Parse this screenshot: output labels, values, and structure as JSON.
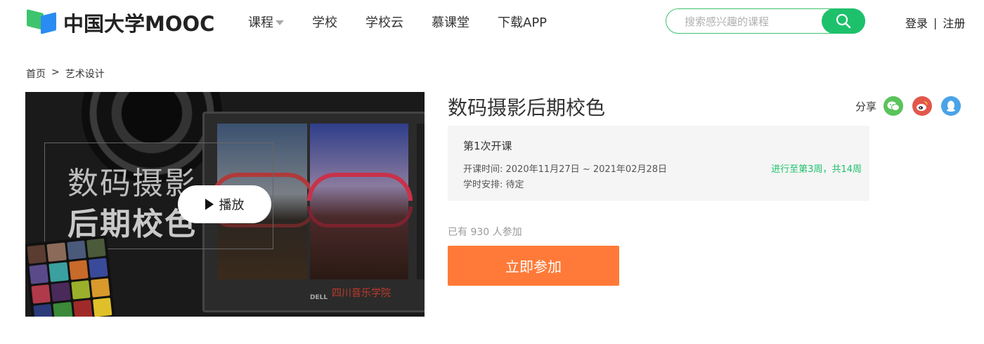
{
  "header": {
    "logo_text": "中国大学MOOC",
    "nav": [
      {
        "label": "课程",
        "has_dropdown": true
      },
      {
        "label": "学校"
      },
      {
        "label": "学校云"
      },
      {
        "label": "慕课堂"
      },
      {
        "label": "下载APP"
      }
    ],
    "search": {
      "placeholder": "搜索感兴趣的课程",
      "icon": "search-icon"
    },
    "auth": {
      "login": "登录",
      "separator": "|",
      "register": "注册"
    }
  },
  "breadcrumb": {
    "home": "首页",
    "arrow": ">",
    "category": "艺术设计"
  },
  "cover": {
    "title_line1": "数码摄影",
    "title_line2": "后期校色",
    "play_label": "播放",
    "watermark": "四川音乐学院",
    "brand": "DELL",
    "checker_colors": [
      "#5a3c30",
      "#8c6a5a",
      "#4a5a7a",
      "#4a5a3a",
      "#5a4a8a",
      "#3aa0a0",
      "#c86a2a",
      "#3a4a9a",
      "#b03a4a",
      "#4a2a5a",
      "#9ab02a",
      "#d89a2a",
      "#2a3a7a",
      "#3a8a3a",
      "#a02a2a",
      "#e0c02a"
    ]
  },
  "course": {
    "title": "数码摄影后期校色",
    "share_label": "分享",
    "share_icons": [
      {
        "name": "wechat-icon",
        "color": "#5ac35a"
      },
      {
        "name": "weibo-icon",
        "color": "#e2574c"
      },
      {
        "name": "qq-icon",
        "color": "#4aa3e8"
      }
    ],
    "term": {
      "name": "第1次开课",
      "time": "开课时间:  2020年11月27日 ~ 2021年02月28日",
      "plan": "学时安排:  待定",
      "progress": "进行至第3周，共14周"
    },
    "enrolled": "已有 930 人参加",
    "join_button": "立即参加"
  },
  "colors": {
    "brand_green": "#1dc16b",
    "accent_orange": "#ff7a38"
  }
}
